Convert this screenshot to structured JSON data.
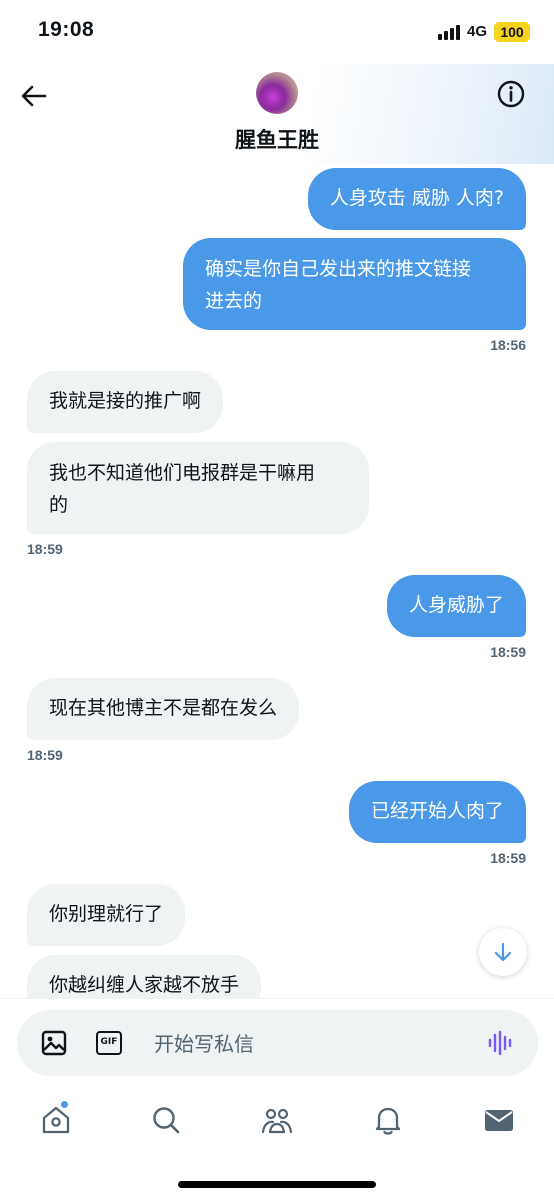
{
  "status_bar": {
    "time": "19:08",
    "network": "4G",
    "battery": "100"
  },
  "header": {
    "contact_name": "腥鱼王胜"
  },
  "messages": [
    {
      "direction": "out",
      "text": "人身攻击 威胁 人肉?"
    },
    {
      "direction": "out",
      "text": "确实是你自己发出来的推文链接进去的",
      "line1": "确实是你自己发出来的推文链接",
      "line2": "进去的"
    },
    {
      "direction": "time",
      "text": "18:56"
    },
    {
      "direction": "in",
      "text": "我就是接的推广啊"
    },
    {
      "direction": "in",
      "text": "我也不知道他们电报群是干嘛用的",
      "line1": "我也不知道他们电报群是干嘛用",
      "line2": "的"
    },
    {
      "direction": "time",
      "text": "18:59"
    },
    {
      "direction": "out",
      "text": "人身威胁了"
    },
    {
      "direction": "time",
      "text": "18:59"
    },
    {
      "direction": "in",
      "text": "现在其他博主不是都在发么"
    },
    {
      "direction": "time",
      "text": "18:59"
    },
    {
      "direction": "out",
      "text": "已经开始人肉了"
    },
    {
      "direction": "time",
      "text": "18:59"
    },
    {
      "direction": "in",
      "text": "你别理就行了"
    },
    {
      "direction": "in",
      "text": "你越纠缠人家越不放手"
    }
  ],
  "composer": {
    "placeholder": "开始写私信",
    "gif_label": "GIF"
  },
  "icons": {
    "back": "arrow-left-icon",
    "info": "info-icon",
    "image": "image-icon",
    "gif": "gif-icon",
    "voice": "voice-wave-icon",
    "scroll": "arrow-down-icon",
    "tabs": [
      "home-icon",
      "search-icon",
      "communities-icon",
      "bell-icon",
      "mail-icon"
    ]
  },
  "colors": {
    "outgoing_bubble": "#4a98e8",
    "incoming_bubble": "#eff3f4",
    "accent": "#4a98e8",
    "voice": "#7856ff",
    "battery": "#f6d31c"
  }
}
